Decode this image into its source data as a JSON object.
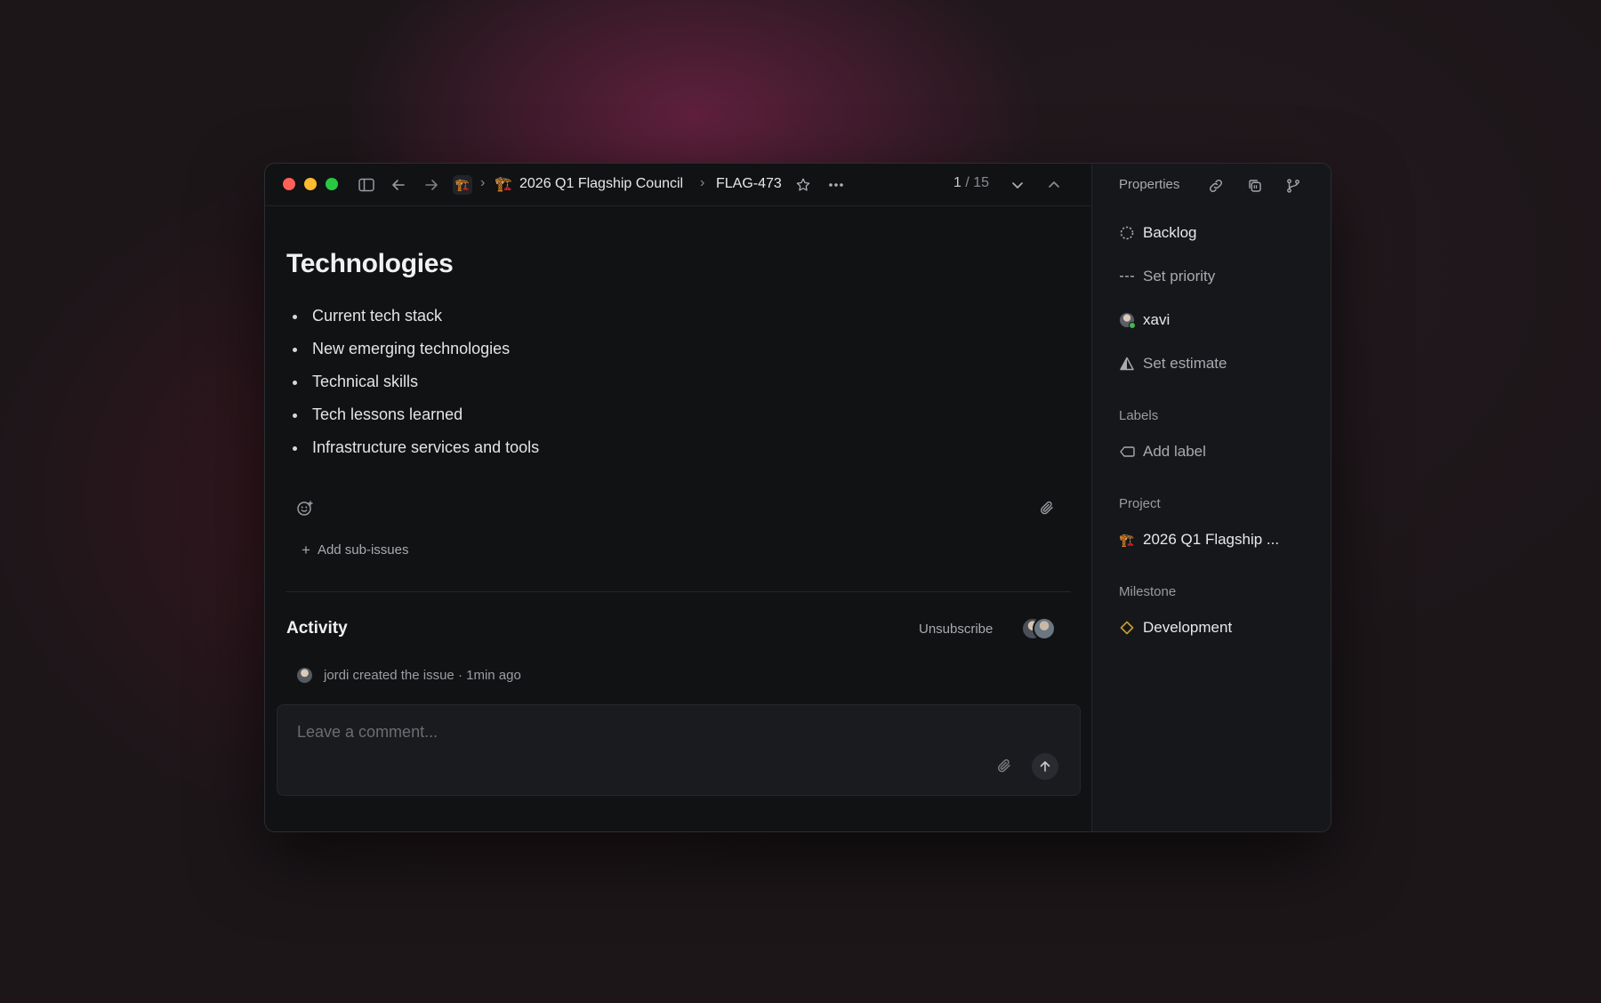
{
  "breadcrumb": {
    "project": "2026 Q1 Flagship Council",
    "issue_id": "FLAG-473"
  },
  "pager": {
    "current": "1",
    "separator": "/",
    "total": "15"
  },
  "issue": {
    "title": "Technologies",
    "bullets": [
      "Current tech stack",
      "New emerging technologies",
      "Technical skills",
      "Tech lessons learned",
      "Infrastructure services and tools"
    ],
    "add_sub_issues": "Add sub-issues"
  },
  "activity": {
    "heading": "Activity",
    "unsubscribe": "Unsubscribe",
    "entry_user": "jordi",
    "entry_action": "created the issue",
    "entry_sep": "·",
    "entry_time": "1min ago"
  },
  "comment": {
    "placeholder": "Leave a comment..."
  },
  "sidebar": {
    "title": "Properties",
    "status": "Backlog",
    "priority": "Set priority",
    "assignee": "xavi",
    "estimate": "Set estimate",
    "labels_heading": "Labels",
    "add_label": "Add label",
    "project_heading": "Project",
    "project": "2026 Q1 Flagship ...",
    "milestone_heading": "Milestone",
    "milestone": "Development"
  },
  "colors": {
    "traffic_close": "#fe5f57",
    "traffic_min": "#febc2e",
    "traffic_max": "#28c840",
    "milestone": "#c59a2e",
    "online": "#3fb950"
  },
  "icons": {
    "project": "🏗️"
  }
}
